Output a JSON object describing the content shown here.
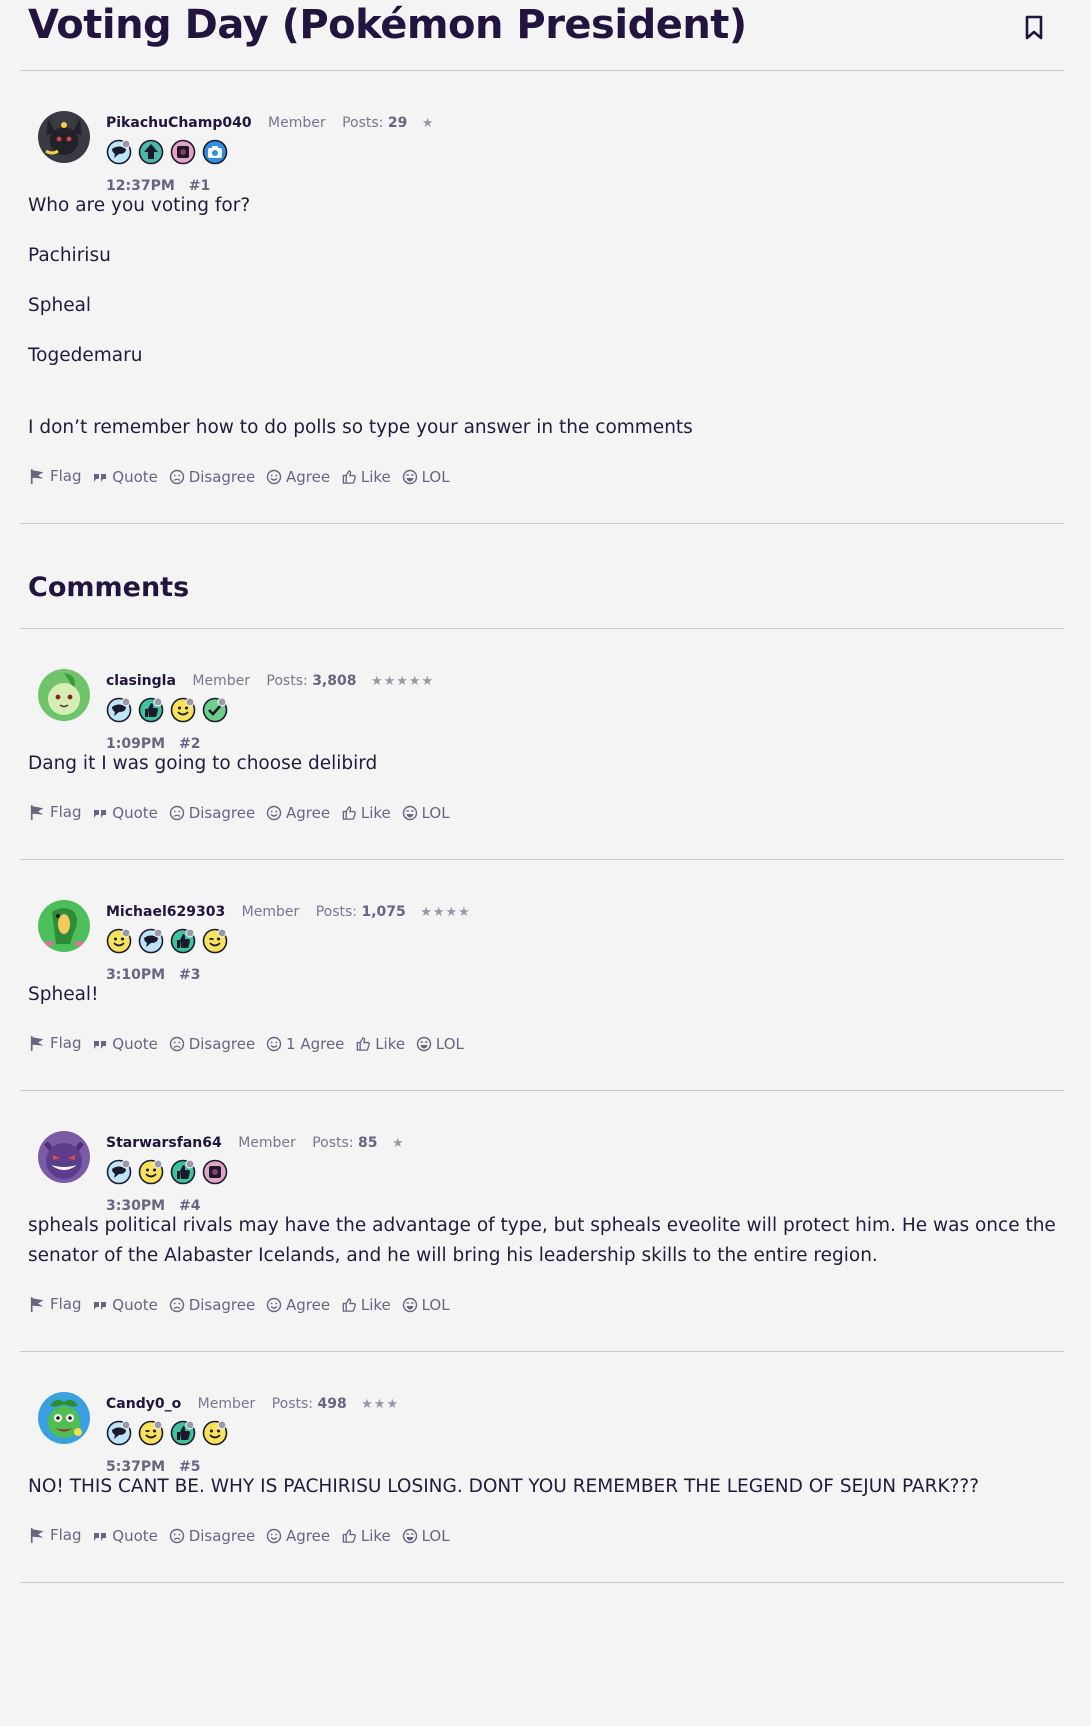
{
  "thread": {
    "title": "Voting Day (Pokémon President)",
    "comments_heading": "Comments"
  },
  "actions": {
    "flag": "Flag",
    "quote": "Quote",
    "disagree": "Disagree",
    "agree": "Agree",
    "like": "Like",
    "lol": "LOL"
  },
  "posts": [
    {
      "username": "PikachuChamp040",
      "role": "Member",
      "posts_label": "Posts:",
      "post_count": "29",
      "stars": "★",
      "time": "12:37PM",
      "number": "#1",
      "body": [
        "Who are you voting for?",
        "Pachirisu",
        "Spheal",
        "Togedemaru",
        "I don’t remember how to do polls so type your answer in the comments"
      ],
      "agree_label": "Agree",
      "avatar": "umbreon-avatar",
      "badges": [
        "speech-bubble-badge",
        "arrow-up-badge",
        "photo-frame-badge",
        "camera-badge"
      ]
    },
    {
      "username": "clasingla",
      "role": "Member",
      "posts_label": "Posts:",
      "post_count": "3,808",
      "stars": "★★★★★",
      "time": "1:09PM",
      "number": "#2",
      "body": [
        "Dang it I was going to choose delibird"
      ],
      "agree_label": "Agree",
      "avatar": "chikorita-avatar",
      "badges": [
        "speech-bubble-badge",
        "thumbs-up-badge",
        "smiley-badge",
        "check-badge"
      ]
    },
    {
      "username": "Michael629303",
      "role": "Member",
      "posts_label": "Posts:",
      "post_count": "1,075",
      "stars": "★★★★",
      "time": "3:10PM",
      "number": "#3",
      "body": [
        "Spheal!"
      ],
      "agree_label": "1 Agree",
      "avatar": "tropius-avatar",
      "badges": [
        "smiley-badge",
        "speech-bubble-badge",
        "thumbs-up-badge",
        "wink-badge"
      ]
    },
    {
      "username": "Starwarsfan64",
      "role": "Member",
      "posts_label": "Posts:",
      "post_count": "85",
      "stars": "★",
      "time": "3:30PM",
      "number": "#4",
      "body": [
        "spheals political rivals may have the advantage of type, but spheals eveolite will protect him. He was once the senator of the Alabaster Icelands, and he will bring his leadership skills to the entire region."
      ],
      "agree_label": "Agree",
      "avatar": "gengar-avatar",
      "badges": [
        "speech-bubble-badge",
        "smiley-badge",
        "thumbs-up-badge",
        "photo-frame-badge"
      ]
    },
    {
      "username": "Candy0_o",
      "role": "Member",
      "posts_label": "Posts:",
      "post_count": "498",
      "stars": "★★★",
      "time": "5:37PM",
      "number": "#5",
      "body": [
        "NO! THIS CANT BE. WHY IS PACHIRISU LOSING. DONT YOU REMEMBER THE LEGEND OF SEJUN PARK???"
      ],
      "agree_label": "Agree",
      "avatar": "politoed-avatar",
      "badges": [
        "speech-bubble-badge",
        "wink-badge",
        "thumbs-up-badge",
        "smiley-badge"
      ]
    }
  ]
}
